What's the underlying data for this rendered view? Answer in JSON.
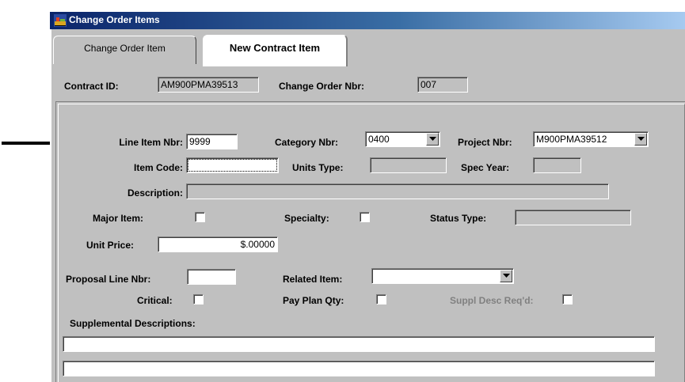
{
  "window": {
    "title": "Change Order Items"
  },
  "tabs": [
    {
      "label": "Change Order Item",
      "active": false
    },
    {
      "label": "New Contract Item",
      "active": true
    }
  ],
  "header": {
    "contract_id_label": "Contract ID:",
    "contract_id_value": "AM900PMA39513",
    "change_order_label": "Change Order Nbr:",
    "change_order_value": "007"
  },
  "form": {
    "line_item_label": "Line Item Nbr:",
    "line_item_value": "9999",
    "category_label": "Category Nbr:",
    "category_value": "0400",
    "project_label": "Project Nbr:",
    "project_value": "M900PMA39512",
    "item_code_label": "Item Code:",
    "item_code_value": "",
    "units_type_label": "Units Type:",
    "units_type_value": "",
    "spec_year_label": "Spec Year:",
    "spec_year_value": "",
    "description_label": "Description:",
    "description_value": "",
    "major_item_label": "Major Item:",
    "major_item_checked": false,
    "specialty_label": "Specialty:",
    "specialty_checked": false,
    "status_type_label": "Status Type:",
    "status_type_value": "",
    "unit_price_label": "Unit Price:",
    "unit_price_value": "$.00000",
    "proposal_line_label": "Proposal Line Nbr:",
    "proposal_line_value": "",
    "related_item_label": "Related Item:",
    "related_item_value": "",
    "critical_label": "Critical:",
    "critical_checked": false,
    "pay_plan_label": "Pay Plan Qty:",
    "pay_plan_checked": false,
    "suppl_desc_label": "Suppl Desc Req'd:",
    "suppl_desc_checked": false,
    "supplemental_label": "Supplemental Descriptions:",
    "supplemental_rows": [
      "",
      ""
    ]
  },
  "colors": {
    "window_bg": "#c0c0c0",
    "title_gradient_start": "#0a246a",
    "title_gradient_end": "#a6caf0"
  },
  "icons": {
    "title_icon": "app-icon",
    "annotation_arrow": "right-arrow-icon",
    "dropdown": "chevron-down-icon"
  }
}
